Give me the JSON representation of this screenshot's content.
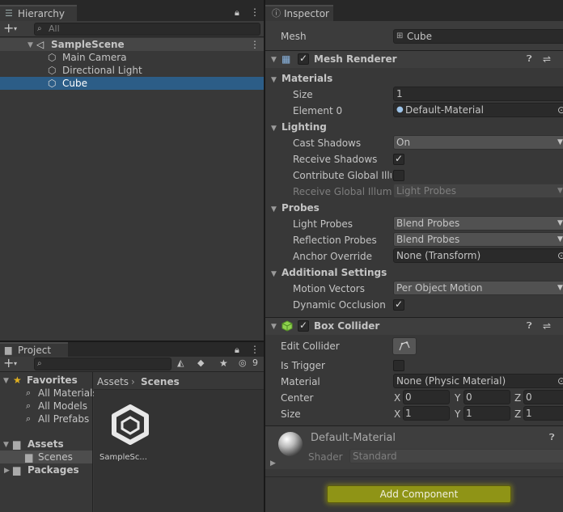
{
  "hierarchy": {
    "tab_label": "Hierarchy",
    "search_placeholder": "All",
    "scene_name": "SampleScene",
    "items": [
      {
        "label": "Main Camera"
      },
      {
        "label": "Directional Light"
      },
      {
        "label": "Cube",
        "selected": true
      }
    ]
  },
  "project": {
    "tab_label": "Project",
    "hidden_count": "9",
    "favorites_label": "Favorites",
    "favorites": [
      "All Materials",
      "All Models",
      "All Prefabs"
    ],
    "assets_label": "Assets",
    "scenes_label": "Scenes",
    "packages_label": "Packages",
    "breadcrumb": [
      "Assets",
      "Scenes"
    ],
    "asset_item": "SampleSc..."
  },
  "inspector": {
    "tab_label": "Inspector",
    "mesh_label": "Mesh",
    "mesh_value": "Cube",
    "mesh_renderer": {
      "title": "Mesh Renderer",
      "materials_label": "Materials",
      "size_label": "Size",
      "size_value": "1",
      "element0_label": "Element 0",
      "element0_value": "Default-Material",
      "lighting_label": "Lighting",
      "cast_shadows_label": "Cast Shadows",
      "cast_shadows_value": "On",
      "receive_shadows_label": "Receive Shadows",
      "receive_shadows_checked": true,
      "contribute_gi_label": "Contribute Global Illum",
      "contribute_gi_checked": false,
      "receive_gi_label": "Receive Global Illumin",
      "receive_gi_value": "Light Probes",
      "probes_label": "Probes",
      "light_probes_label": "Light Probes",
      "light_probes_value": "Blend Probes",
      "reflection_probes_label": "Reflection Probes",
      "reflection_probes_value": "Blend Probes",
      "anchor_override_label": "Anchor Override",
      "anchor_override_value": "None (Transform)",
      "additional_label": "Additional Settings",
      "motion_vectors_label": "Motion Vectors",
      "motion_vectors_value": "Per Object Motion",
      "dynamic_occlusion_label": "Dynamic Occlusion",
      "dynamic_occlusion_checked": true
    },
    "box_collider": {
      "title": "Box Collider",
      "edit_collider_label": "Edit Collider",
      "is_trigger_label": "Is Trigger",
      "is_trigger_checked": false,
      "material_label": "Material",
      "material_value": "None (Physic Material)",
      "center_label": "Center",
      "center": {
        "x": "0",
        "y": "0",
        "z": "0"
      },
      "size_label": "Size",
      "size": {
        "x": "1",
        "y": "1",
        "z": "1"
      },
      "axis_x": "X",
      "axis_y": "Y",
      "axis_z": "Z"
    },
    "material_preview": {
      "name": "Default-Material",
      "shader_label": "Shader",
      "shader_value": "Standard"
    },
    "add_component_label": "Add Component"
  },
  "colors": {
    "selection": "#2c5d87",
    "highlight": "#c8c800",
    "collider_icon": "#8fd14f",
    "star": "#e0b020"
  }
}
